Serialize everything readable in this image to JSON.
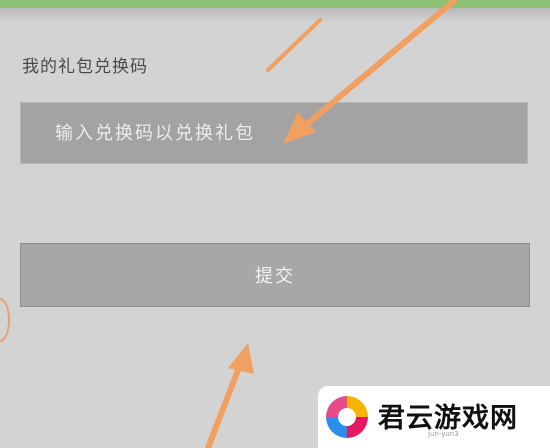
{
  "redeem": {
    "title": "我的礼包兑换码",
    "input_placeholder": "输入兑换码以兑换礼包",
    "submit_label": "提交"
  },
  "watermark": {
    "name": "君云游戏网",
    "domain": "jun-yun3"
  },
  "colors": {
    "background": "#d3d3d3",
    "top_strip": "#8cc173",
    "input_bg": "#a3a3a3",
    "button_bg": "#a7a7a7",
    "annotation_arrow": "#f0a060"
  }
}
